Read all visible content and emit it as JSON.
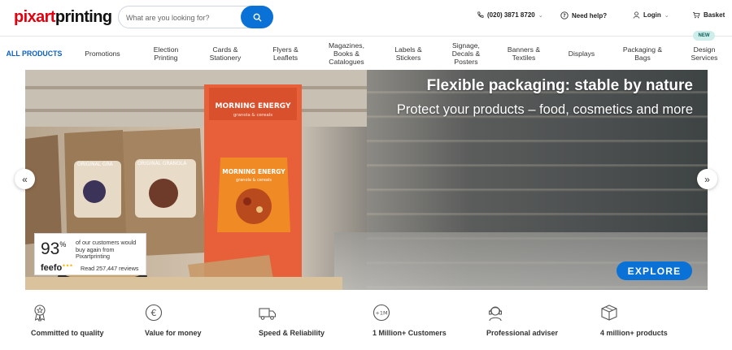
{
  "header": {
    "logo": "pixartprinting",
    "search": {
      "placeholder": "What are you looking for?"
    },
    "phone": "(020) 3871 8720",
    "help": "Need help?",
    "login": "Login",
    "basket": "Basket"
  },
  "nav": {
    "items": [
      {
        "label": "ALL PRODUCTS"
      },
      {
        "label": "Promotions"
      },
      {
        "label": "Election\nPrinting"
      },
      {
        "label": "Cards &\nStationery"
      },
      {
        "label": "Flyers &\nLeaflets"
      },
      {
        "label": "Magazines,\nBooks &\nCatalogues"
      },
      {
        "label": "Labels &\nStickers"
      },
      {
        "label": "Signage,\nDecals &\nPosters"
      },
      {
        "label": "Banners &\nTextiles"
      },
      {
        "label": "Displays"
      },
      {
        "label": "Packaging &\nBags"
      },
      {
        "label": "Design\nServices"
      }
    ],
    "new_badge": "NEW"
  },
  "hero": {
    "title": "Flexible packaging: stable by nature",
    "subtitle": "Protect your products – food, cosmetics and more",
    "cta": "EXPLORE",
    "product_text": {
      "pouch_brand": "MORNING ENERGY",
      "pouch_sub": "granola & cereals",
      "bag_label": "ORIGINAL GRANOLA"
    }
  },
  "feefo": {
    "percent": "93",
    "percent_sign": "%",
    "text": "of our customers would buy again from Pixartprinting",
    "brand": "feefo",
    "reviews": "Read 257,447 reviews"
  },
  "features": [
    {
      "label": "Committed to quality",
      "icon": "award-ribbon-icon"
    },
    {
      "label": "Value for money",
      "icon": "euro-coin-icon"
    },
    {
      "label": "Speed & Reliability",
      "icon": "delivery-truck-icon"
    },
    {
      "label": "1 Million+ Customers",
      "icon": "customers-plus-icon"
    },
    {
      "label": "Professional adviser",
      "icon": "headset-adviser-icon"
    },
    {
      "label": "4 million+ products",
      "icon": "box-icon"
    }
  ],
  "colors": {
    "brand_red": "#e3000f",
    "accent_blue": "#0a72d6",
    "nav_active": "#0b5fbf",
    "new_badge_bg": "#cdeeea"
  }
}
